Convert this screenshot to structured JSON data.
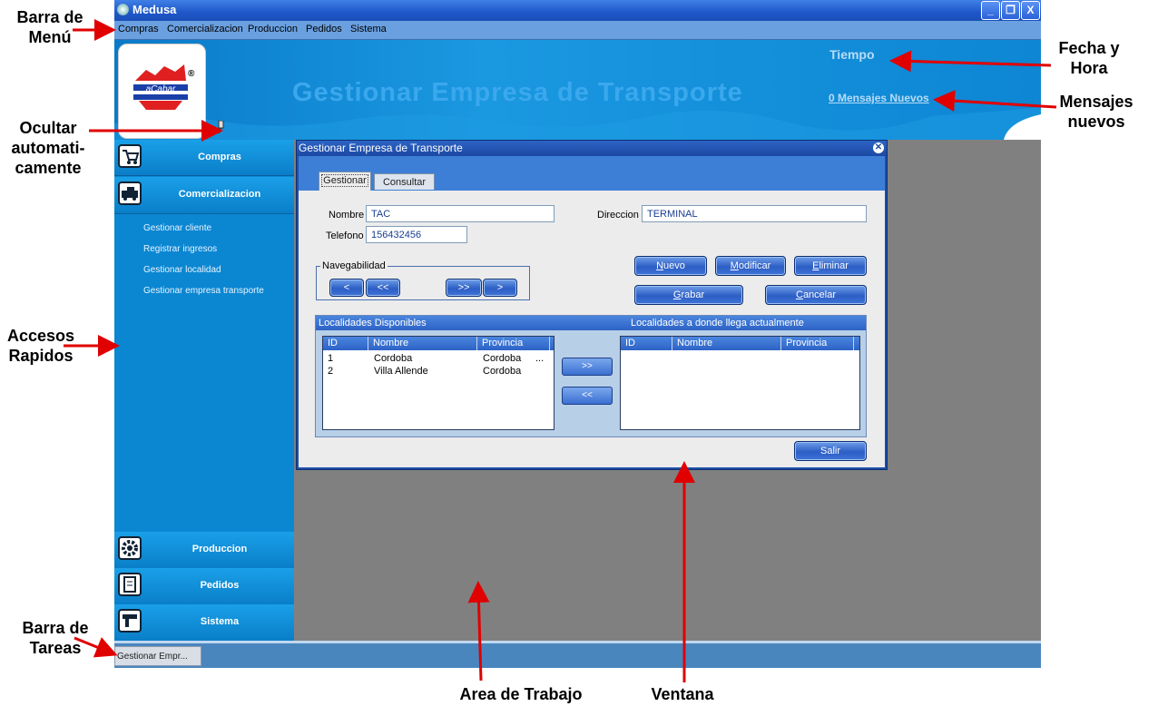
{
  "annotations": {
    "menu_bar": [
      "Barra de",
      "Menú"
    ],
    "date_time": [
      "Fecha y",
      "Hora"
    ],
    "new_messages": [
      "Mensajes",
      "nuevos"
    ],
    "auto_hide": [
      "Ocultar",
      "automati-",
      "camente"
    ],
    "quick_access": [
      "Accesos",
      "Rapidos"
    ],
    "taskbar": [
      "Barra de",
      "Tareas"
    ],
    "work_area": "Area de Trabajo",
    "window": "Ventana"
  },
  "app": {
    "title": "Medusa",
    "window_controls": [
      "_",
      "❐",
      "X"
    ]
  },
  "menu": [
    "Compras",
    "Comercializacion",
    "Produccion",
    "Pedidos",
    "Sistema"
  ],
  "banner": {
    "title": "Gestionar Empresa de Transporte",
    "time_label": "Tiempo",
    "messages_link": "0 Mensajes Nuevos",
    "logo_mark": "®"
  },
  "sidebar": {
    "top_sections": [
      {
        "label": "Compras",
        "icon": "shopping-cart-icon"
      },
      {
        "label": "Comercializacion",
        "icon": "truck-icon"
      }
    ],
    "sub_items": [
      "Gestionar cliente",
      "Registrar ingresos",
      "Gestionar localidad",
      "Gestionar empresa transporte"
    ],
    "bottom_sections": [
      {
        "label": "Produccion",
        "icon": "gear-icon"
      },
      {
        "label": "Pedidos",
        "icon": "document-icon"
      },
      {
        "label": "Sistema",
        "icon": "drill-icon"
      }
    ]
  },
  "taskbar": {
    "item": "Gestionar Empr..."
  },
  "dialog": {
    "title": "Gestionar Empresa de Transporte",
    "tabs": [
      "Gestionar",
      "Consultar"
    ],
    "active_tab": "Gestionar",
    "fields": {
      "nombre": {
        "label": "Nombre",
        "value": "TAC"
      },
      "telefono": {
        "label": "Telefono",
        "value": "156432456"
      },
      "direccion": {
        "label": "Direccion",
        "value": "TERMINAL"
      }
    },
    "navigation": {
      "legend": "Navegabilidad",
      "buttons": [
        "<",
        "<<",
        ">>",
        ">"
      ]
    },
    "actions": {
      "nuevo": {
        "mnemonic": "N",
        "rest": "uevo"
      },
      "modificar": {
        "mnemonic": "M",
        "rest": "odificar"
      },
      "eliminar": {
        "mnemonic": "E",
        "rest": "liminar"
      },
      "grabar": {
        "mnemonic": "G",
        "rest": "rabar"
      },
      "cancelar": {
        "mnemonic": "C",
        "rest": "ancelar"
      },
      "salir": "Salir"
    },
    "localidades": {
      "available_header": "Localidades Disponibles",
      "current_header": "Localidades a donde llega actualmente",
      "columns": [
        "ID",
        "Nombre",
        "Provincia"
      ],
      "available_rows": [
        {
          "id": "1",
          "nombre": "Cordoba",
          "provincia": "Cordoba",
          "more": "..."
        },
        {
          "id": "2",
          "nombre": "Villa Allende",
          "provincia": "Cordoba",
          "more": ""
        }
      ],
      "move_buttons": [
        ">>",
        "<<"
      ]
    }
  },
  "colors": {
    "title_bar": "#1f57c9",
    "banner": "#0d86d3",
    "sidebar": "#0b87d2",
    "work_area": "#808080",
    "arrow": "#e00000"
  }
}
